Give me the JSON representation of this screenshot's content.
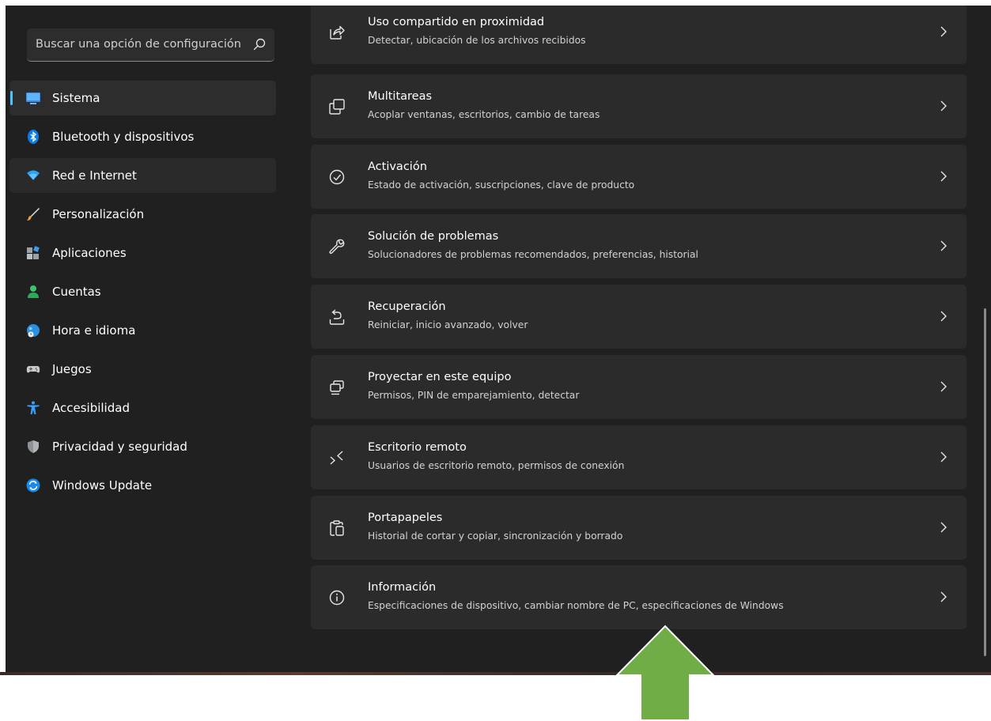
{
  "search": {
    "placeholder": "Buscar una opción de configuración"
  },
  "sidebar": {
    "items": [
      {
        "label": "Sistema",
        "icon": "monitor-icon",
        "selected": true
      },
      {
        "label": "Bluetooth y dispositivos",
        "icon": "bluetooth-icon"
      },
      {
        "label": "Red e Internet",
        "icon": "wifi-icon",
        "hover": true
      },
      {
        "label": "Personalización",
        "icon": "brush-icon"
      },
      {
        "label": "Aplicaciones",
        "icon": "apps-icon"
      },
      {
        "label": "Cuentas",
        "icon": "person-icon"
      },
      {
        "label": "Hora e idioma",
        "icon": "globe-clock-icon"
      },
      {
        "label": "Juegos",
        "icon": "gamepad-icon"
      },
      {
        "label": "Accesibilidad",
        "icon": "accessibility-icon"
      },
      {
        "label": "Privacidad y seguridad",
        "icon": "shield-icon"
      },
      {
        "label": "Windows Update",
        "icon": "update-icon"
      }
    ]
  },
  "main": {
    "items": [
      {
        "title": "Uso compartido en proximidad",
        "desc": "Detectar, ubicación de los archivos recibidos",
        "icon": "share-icon"
      },
      {
        "title": "Multitareas",
        "desc": "Acoplar ventanas, escritorios, cambio de tareas",
        "icon": "multitask-icon"
      },
      {
        "title": "Activación",
        "desc": "Estado de activación, suscripciones, clave de producto",
        "icon": "check-circle-icon"
      },
      {
        "title": "Solución de problemas",
        "desc": "Solucionadores de problemas recomendados, preferencias, historial",
        "icon": "wrench-icon"
      },
      {
        "title": "Recuperación",
        "desc": "Reiniciar, inicio avanzado, volver",
        "icon": "recovery-icon"
      },
      {
        "title": "Proyectar en este equipo",
        "desc": "Permisos, PIN de emparejamiento, detectar",
        "icon": "project-icon"
      },
      {
        "title": "Escritorio remoto",
        "desc": "Usuarios de escritorio remoto, permisos de conexión",
        "icon": "remote-desktop-icon"
      },
      {
        "title": "Portapapeles",
        "desc": "Historial de cortar y copiar, sincronización y borrado",
        "icon": "clipboard-icon"
      },
      {
        "title": "Información",
        "desc": "Especificaciones de dispositivo, cambiar nombre de PC, especificaciones de Windows",
        "icon": "info-icon"
      }
    ]
  },
  "colors": {
    "window_bg": "#202020",
    "card_bg": "#2b2b2b",
    "accent": "#4cc2ff",
    "annotation_arrow": "#70ad47"
  },
  "annotation": {
    "type": "arrow",
    "direction": "up",
    "points_to": "Información"
  }
}
